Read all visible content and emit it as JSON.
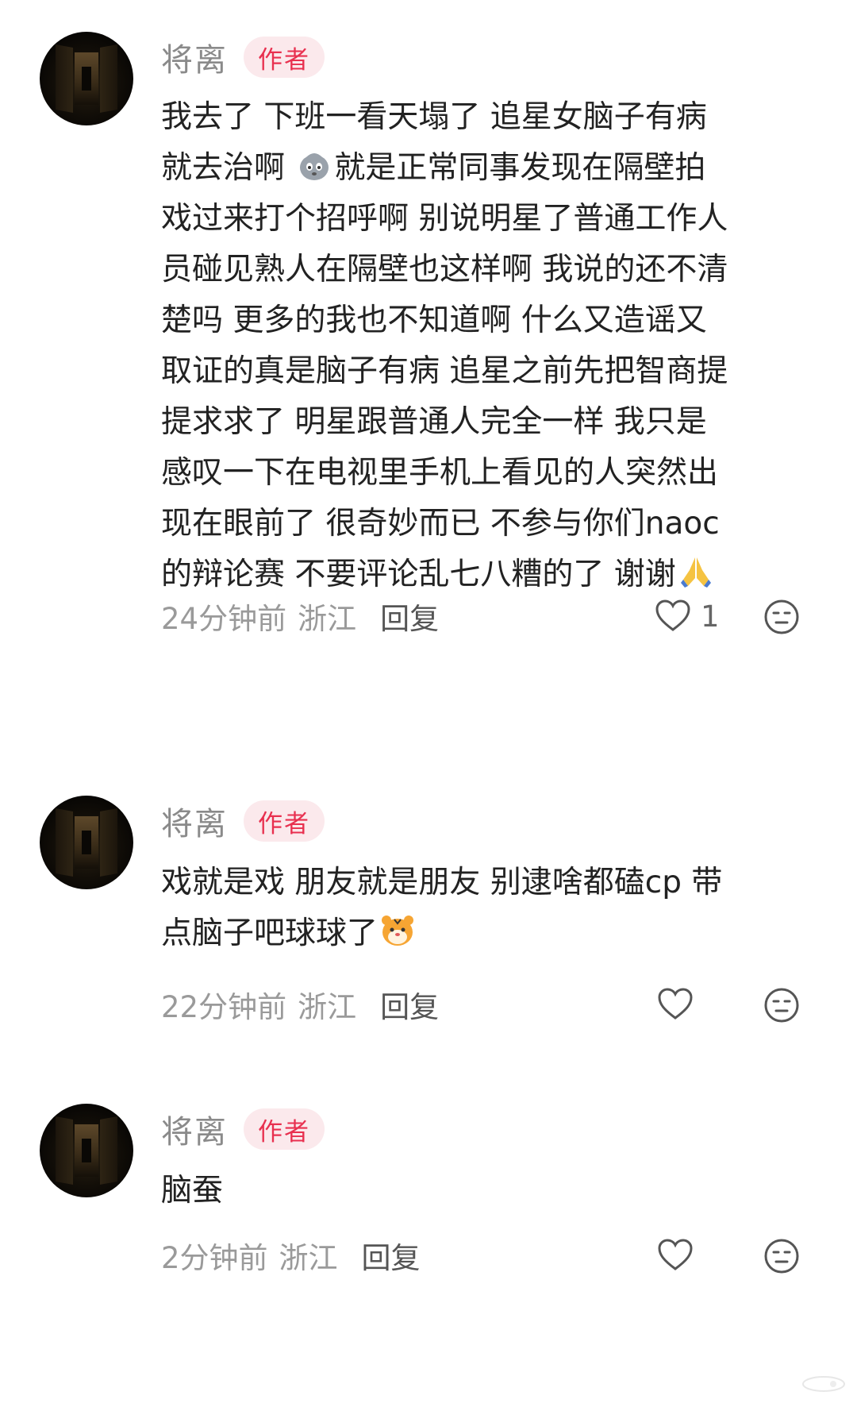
{
  "comments": [
    {
      "username": "将离",
      "badge": "作者",
      "text_before_emoji": "我去了 下班一看天塌了 追星女脑子有病\n就去治啊 ",
      "text_after_emoji": "就是正常同事发现在隔壁拍\n戏过来打个招呼啊 别说明星了普通工作人\n员碰见熟人在隔壁也这样啊 我说的还不清\n楚吗 更多的我也不知道啊 什么又造谣又\n取证的真是脑子有病 追星之前先把智商提\n提求求了 明星跟普通人完全一样 我只是\n感叹一下在电视里手机上看见的人突然出\n现在眼前了 很奇妙而已 不参与你们naoc\n的辩论赛 不要评论乱七八糟的了 谢谢",
      "emoji_inline": "blob-face-emoji",
      "emoji_end": "folded-hands-emoji",
      "time": "24分钟前",
      "region": "浙江",
      "reply_label": "回复",
      "like_count": "1"
    },
    {
      "username": "将离",
      "badge": "作者",
      "text": "戏就是戏 朋友就是朋友 别逮啥都磕cp 带\n点脑子吧球球了",
      "emoji_end": "tiger-face-emoji",
      "time": "22分钟前",
      "region": "浙江",
      "reply_label": "回复",
      "like_count": ""
    },
    {
      "username": "将离",
      "badge": "作者",
      "text": "脑蚕",
      "time": "2分钟前",
      "region": "浙江",
      "reply_label": "回复",
      "like_count": ""
    }
  ],
  "icons": {
    "like": "heart-outline-icon",
    "reaction": "neutral-face-icon"
  },
  "colors": {
    "badge_text": "#e8304f",
    "badge_bg": "#fbe9ec",
    "username": "#8a8a8a",
    "meta": "#9a9a9a"
  }
}
